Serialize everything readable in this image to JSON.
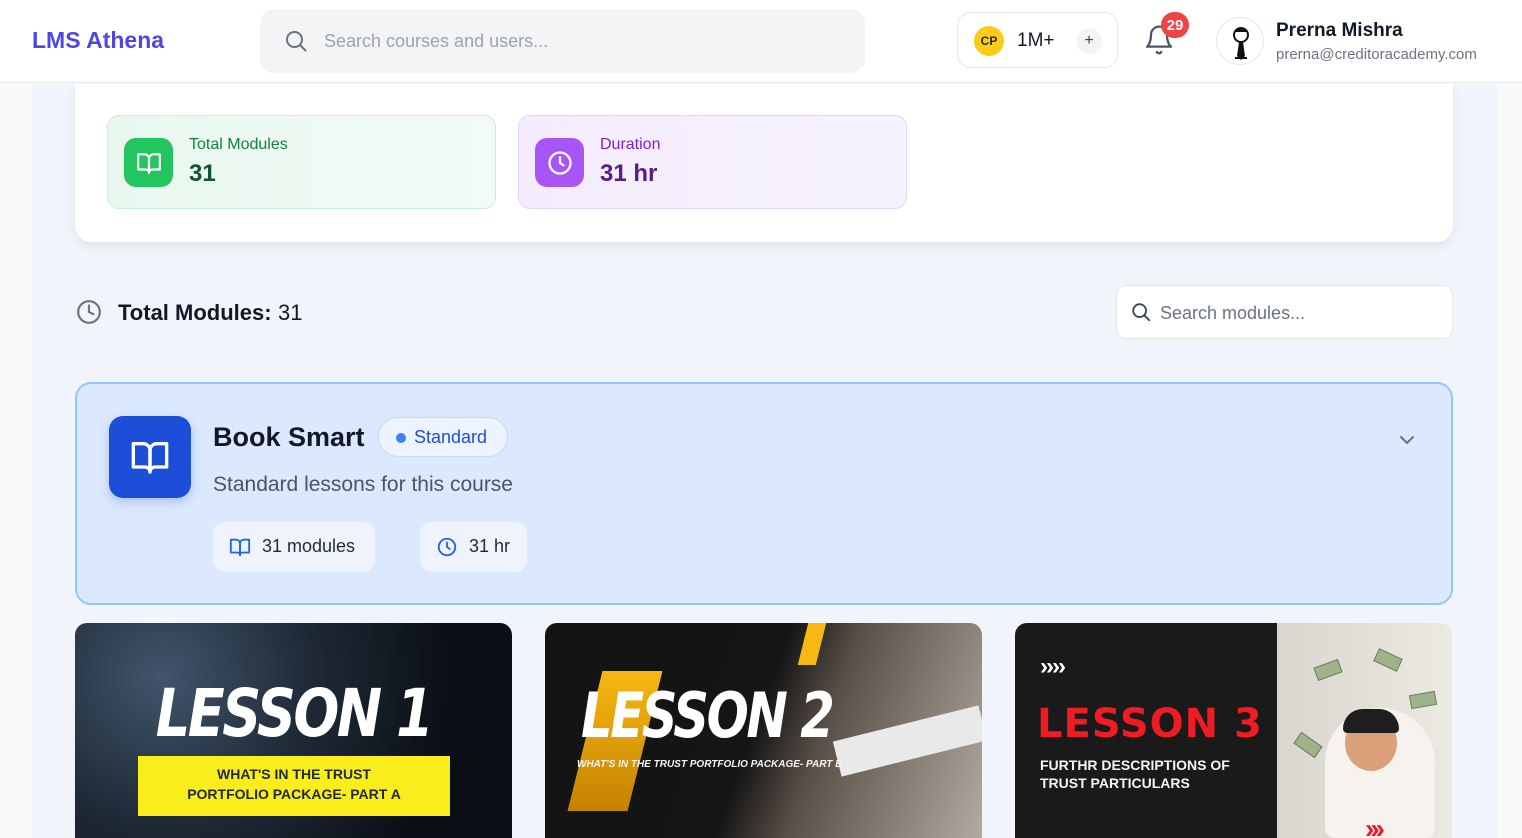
{
  "app": {
    "brand": "LMS Athena"
  },
  "header": {
    "search_placeholder": "Search courses and users...",
    "points": {
      "badge": "CP",
      "value": "1M+",
      "add": "+"
    },
    "notifications_count": "29",
    "user": {
      "name": "Prerna Mishra",
      "email": "prerna@creditoracademy.com"
    }
  },
  "stats": {
    "modules": {
      "label": "Total Modules",
      "value": "31"
    },
    "duration": {
      "label": "Duration",
      "value": "31 hr"
    }
  },
  "modules_bar": {
    "label": "Total Modules:",
    "value": "31",
    "search_placeholder": "Search modules..."
  },
  "course": {
    "title": "Book Smart",
    "badge": "Standard",
    "description": "Standard lessons for this course",
    "modules_chip": "31 modules",
    "duration_chip": "31 hr"
  },
  "lessons": [
    {
      "title": "LESSON 1",
      "subtitle_line1": "WHAT'S IN THE TRUST",
      "subtitle_line2": "PORTFOLIO PACKAGE- PART A"
    },
    {
      "title": "LESSON 2",
      "subtitle": "WHAT'S IN THE TRUST PORTFOLIO PACKAGE- PART B"
    },
    {
      "title": "LESSON 3",
      "subtitle_line1": "FURTHR DESCRIPTIONS OF",
      "subtitle_line2": "TRUST PARTICULARS",
      "arrows": "››››"
    }
  ],
  "colors": {
    "brand": "#4f46e5",
    "modules_accent": "#22c55e",
    "duration_accent": "#a855f7",
    "course_icon": "#1d4ed8",
    "notification": "#ef4444"
  }
}
